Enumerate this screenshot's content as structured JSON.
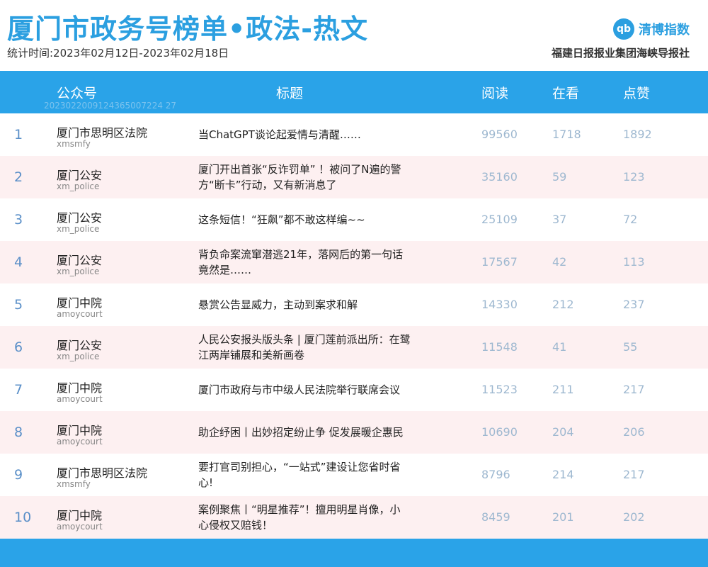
{
  "header": {
    "title": "厦门市政务号榜单•政法-热文",
    "period": "统计时间:2023年02月12日-2023年02月18日",
    "logo_mark": "qb",
    "logo_text": "清博指数",
    "publisher": "福建日报报业集团海峡导报社"
  },
  "table": {
    "columns": {
      "account": "公众号",
      "title": "标题",
      "read": "阅读",
      "watching": "在看",
      "likes": "点赞"
    },
    "serial": "2023022009124365007224 27",
    "rows": [
      {
        "rank": "1",
        "account": "厦门市思明区法院",
        "account_id": "xmsmfy",
        "title": "当ChatGPT谈论起爱情与清醒……",
        "read": "99560",
        "watching": "1718",
        "likes": "1892"
      },
      {
        "rank": "2",
        "account": "厦门公安",
        "account_id": "xm_police",
        "title": "厦门开出首张“反诈罚单” ！被问了N遍的警方“断卡”行动，又有新消息了",
        "read": "35160",
        "watching": "59",
        "likes": "123"
      },
      {
        "rank": "3",
        "account": "厦门公安",
        "account_id": "xm_police",
        "title": "这条短信！“狂飙”都不敢这样编~~",
        "read": "25109",
        "watching": "37",
        "likes": "72"
      },
      {
        "rank": "4",
        "account": "厦门公安",
        "account_id": "xm_police",
        "title": "背负命案流窜潜逃21年，落网后的第一句话竟然是……",
        "read": "17567",
        "watching": "42",
        "likes": "113"
      },
      {
        "rank": "5",
        "account": "厦门中院",
        "account_id": "amoycourt",
        "title": "悬赏公告显威力，主动到案求和解",
        "read": "14330",
        "watching": "212",
        "likes": "237"
      },
      {
        "rank": "6",
        "account": "厦门公安",
        "account_id": "xm_police",
        "title": "人民公安报头版头条 | 厦门莲前派出所：在鹭江两岸铺展和美新画卷",
        "read": "11548",
        "watching": "41",
        "likes": "55"
      },
      {
        "rank": "7",
        "account": "厦门中院",
        "account_id": "amoycourt",
        "title": "厦门市政府与市中级人民法院举行联席会议",
        "read": "11523",
        "watching": "211",
        "likes": "217"
      },
      {
        "rank": "8",
        "account": "厦门中院",
        "account_id": "amoycourt",
        "title": "助企纾困丨出妙招定纷止争 促发展暖企惠民",
        "read": "10690",
        "watching": "204",
        "likes": "206"
      },
      {
        "rank": "9",
        "account": "厦门市思明区法院",
        "account_id": "xmsmfy",
        "title": "要打官司别担心，“一站式”建设让您省时省心!",
        "read": "8796",
        "watching": "214",
        "likes": "217"
      },
      {
        "rank": "10",
        "account": "厦门中院",
        "account_id": "amoycourt",
        "title": "案例聚焦丨“明星推荐”！擅用明星肖像，小心侵权又赔钱！",
        "read": "8459",
        "watching": "201",
        "likes": "202"
      }
    ]
  },
  "colors": {
    "accent": "#2aa3e8",
    "title": "#2b9fe0",
    "row_alt": "#fdf0f1",
    "number": "#9eb8d0",
    "rank": "#5a8fc8"
  }
}
